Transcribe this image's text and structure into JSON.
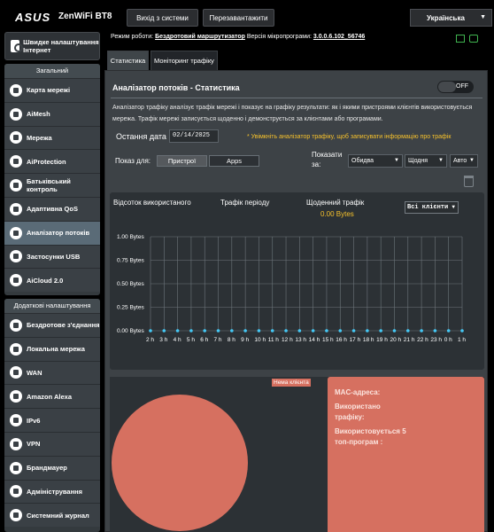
{
  "header": {
    "brand": "ASUS",
    "model": "ZenWiFi BT8",
    "logout_label": "Вихід з системи",
    "reboot_label": "Перезавантажити",
    "language": "Українська"
  },
  "status": {
    "mode_label": "Режим роботи:",
    "mode_value": "Бездротовий маршрутизатор",
    "firmware_label": "Версія мікропрограми:",
    "firmware_value": "3.0.0.6.102_56746"
  },
  "sidebar": {
    "quick_setup": "Швидке налаштування Інтернет",
    "general_title": "Загальний",
    "general_items": [
      {
        "label": "Карта мережі",
        "name": "network-map"
      },
      {
        "label": "AiMesh",
        "name": "aimesh"
      },
      {
        "label": "Мережа",
        "name": "network"
      },
      {
        "label": "AiProtection",
        "name": "aiprotection"
      },
      {
        "label": "Батьківський контроль",
        "name": "parental-control"
      },
      {
        "label": "Адаптивна QoS",
        "name": "adaptive-qos"
      },
      {
        "label": "Аналізатор потоків",
        "name": "traffic-analyzer"
      },
      {
        "label": "Застосунки USB",
        "name": "usb-apps"
      },
      {
        "label": "AiCloud 2.0",
        "name": "aicloud"
      }
    ],
    "advanced_title": "Додаткові налаштування",
    "advanced_items": [
      {
        "label": "Бездротове з'єднання",
        "name": "wireless"
      },
      {
        "label": "Локальна мережа",
        "name": "lan"
      },
      {
        "label": "WAN",
        "name": "wan"
      },
      {
        "label": "Amazon Alexa",
        "name": "alexa"
      },
      {
        "label": "IPv6",
        "name": "ipv6"
      },
      {
        "label": "VPN",
        "name": "vpn"
      },
      {
        "label": "Брандмауер",
        "name": "firewall"
      },
      {
        "label": "Адміністрування",
        "name": "administration"
      },
      {
        "label": "Системний журнал",
        "name": "system-log"
      }
    ]
  },
  "tabs": [
    "Статистика",
    "Моніторинг трафіку"
  ],
  "main": {
    "title": "Аналізатор потоків - Статистика",
    "toggle_label": "OFF",
    "description": "Аналізатор трафіку аналізує трафік мережі і показує на графіку результати: як і якими пристроями клієнтів використовується мережа. Трафік мережі записується щоденно і демонструється за клієнтами або програмами.",
    "date_label": "Остання дата",
    "date_value": "02/14/2025",
    "warning": "* Увімкніть аналізатор трафіку, щоб записувати інформацію про трафік",
    "show_for_label": "Показ для:",
    "show_for_options": [
      "Пристрої",
      "Apps"
    ],
    "show_label": "Показати за:",
    "select_mode": "Обидва",
    "select_period": "Щодня",
    "select_unit": "Авто"
  },
  "chart_header": {
    "used_label": "Відсоток використаного",
    "period_label": "Трафік періоду",
    "daily_label": "Щоденний трафік",
    "daily_value": "0.00 Bytes",
    "client_select": "Всі клієнти"
  },
  "chart_data": {
    "type": "line",
    "categories": [
      "2 h",
      "3 h",
      "4 h",
      "5 h",
      "6 h",
      "7 h",
      "8 h",
      "9 h",
      "10 h",
      "11 h",
      "12 h",
      "13 h",
      "14 h",
      "15 h",
      "16 h",
      "17 h",
      "18 h",
      "19 h",
      "20 h",
      "21 h",
      "22 h",
      "23 h",
      "0 h",
      "1 h"
    ],
    "values": [
      0,
      0,
      0,
      0,
      0,
      0,
      0,
      0,
      0,
      0,
      0,
      0,
      0,
      0,
      0,
      0,
      0,
      0,
      0,
      0,
      0,
      0,
      0,
      0
    ],
    "yticks": [
      "0.00 Bytes",
      "0.25 Bytes",
      "0.50 Bytes",
      "0.75 Bytes",
      "1.00 Bytes"
    ],
    "ylim": [
      0,
      1
    ],
    "grid": true,
    "colors": {
      "grid": "#6e767c",
      "point": "#44c8f5"
    }
  },
  "bottom": {
    "no_client_tag": "Нема клієнта",
    "mac_label": "MAC-адреса:",
    "used_label": "Використано трафіку:",
    "top_apps_label": "Використовується 5 топ-програм :",
    "pie_color": "#d67060"
  }
}
